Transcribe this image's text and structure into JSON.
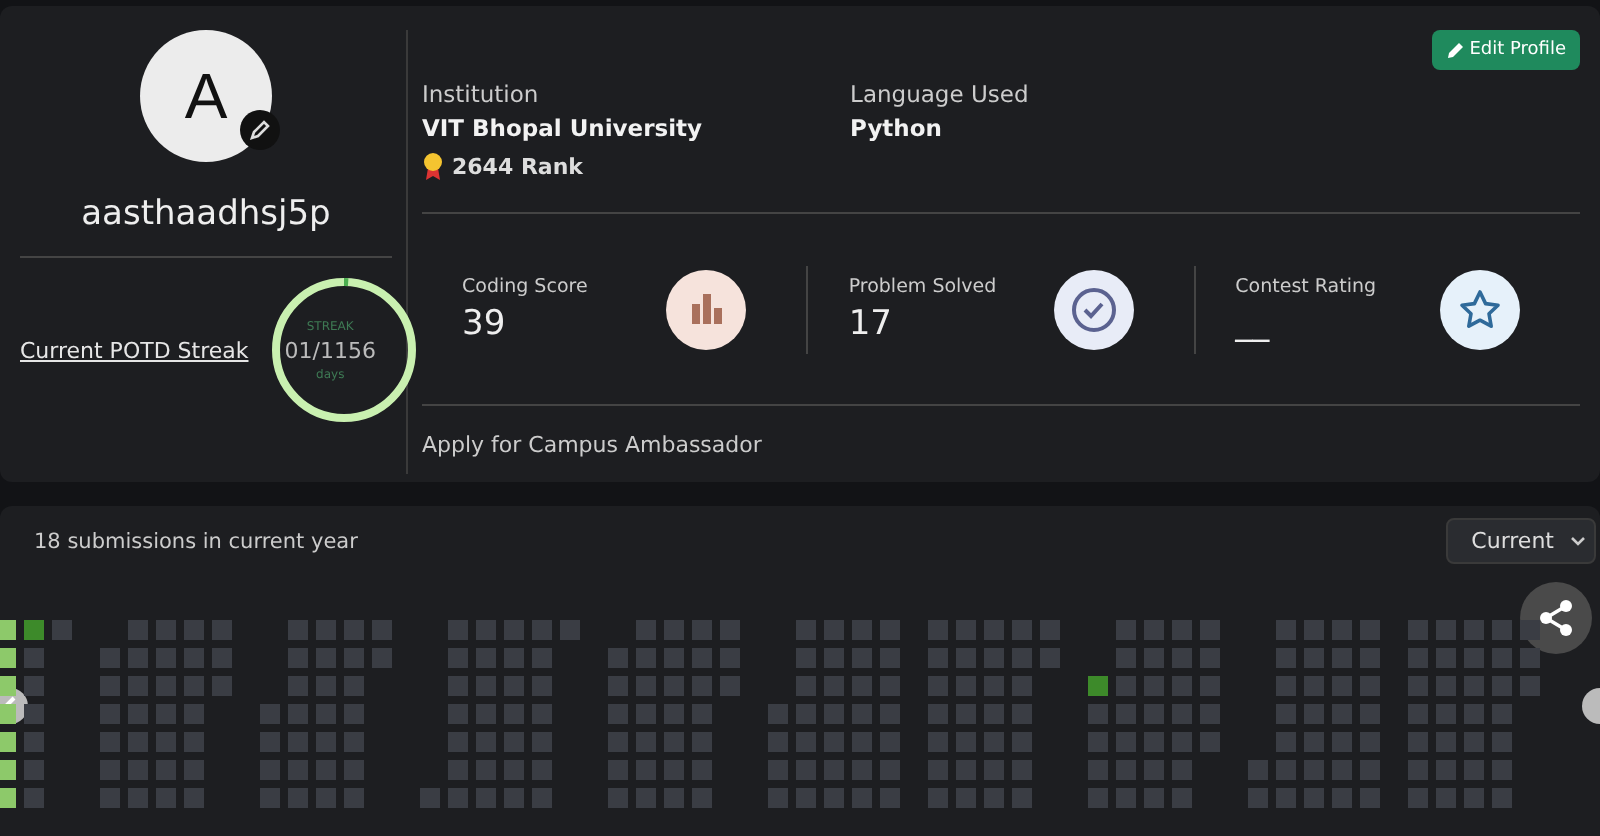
{
  "profile": {
    "avatar_letter": "A",
    "username": "aasthaadhsj5p",
    "streak_link": "Current POTD Streak",
    "streak": {
      "label": "STREAK",
      "value": "01/1156",
      "unit": "days",
      "level": 0.01
    }
  },
  "edit_button": "Edit Profile",
  "info": [
    {
      "label": "Institution",
      "value": "VIT Bhopal University",
      "rank": "2644 Rank"
    },
    {
      "label": "Language Used",
      "value": "Python"
    }
  ],
  "stats": [
    {
      "label": "Coding Score",
      "value": "39",
      "kind": "score"
    },
    {
      "label": "Problem Solved",
      "value": "17",
      "kind": "solved"
    },
    {
      "label": "Contest Rating",
      "value": "__",
      "kind": "rating"
    }
  ],
  "campus_link": "Apply for Campus Ambassador",
  "submissions": {
    "title": "18 submissions in current year",
    "year_select": "Current"
  },
  "heatmap": {
    "months": [
      {
        "weeks": [
          {
            "cells": [
              {
                "color": "#8dc96a"
              },
              {
                "color": "#8dc96a"
              },
              {
                "color": "#8dc96a"
              },
              {
                "color": "#8dc96a"
              },
              {
                "color": "#8dc96a"
              },
              {
                "color": "#8dc96a"
              },
              {
                "color": "#8dc96a"
              }
            ]
          },
          {
            "cells": [
              {
                "color": "#3d8a2a"
              },
              {
                "color": "#3a3d44"
              },
              {
                "color": "#3a3d44"
              },
              {
                "color": "#3a3d44"
              },
              {
                "color": "#3a3d44"
              },
              {
                "color": "#3a3d44"
              },
              {
                "color": "#3a3d44"
              }
            ]
          },
          {
            "cells": [
              {
                "color": "#3a3d44"
              }
            ]
          }
        ]
      },
      {
        "weeks": [
          {
            "bottom": true,
            "cells": [
              {
                "color": "#3a3d44"
              },
              {
                "color": "#3a3d44"
              },
              {
                "color": "#3a3d44"
              },
              {
                "color": "#3a3d44"
              },
              {
                "color": "#3a3d44"
              },
              {
                "color": "#3a3d44"
              }
            ]
          },
          {
            "cells": [
              {
                "color": "#3a3d44"
              },
              {
                "color": "#3a3d44"
              },
              {
                "color": "#3a3d44"
              },
              {
                "color": "#3a3d44"
              },
              {
                "color": "#3a3d44"
              },
              {
                "color": "#3a3d44"
              },
              {
                "color": "#3a3d44"
              }
            ]
          },
          {
            "cells": [
              {
                "color": "#3a3d44"
              },
              {
                "color": "#3a3d44"
              },
              {
                "color": "#3a3d44"
              },
              {
                "color": "#3a3d44"
              },
              {
                "color": "#3a3d44"
              },
              {
                "color": "#3a3d44"
              },
              {
                "color": "#3a3d44"
              }
            ]
          },
          {
            "cells": [
              {
                "color": "#3a3d44"
              },
              {
                "color": "#3a3d44"
              },
              {
                "color": "#3a3d44"
              },
              {
                "color": "#3a3d44"
              },
              {
                "color": "#3a3d44"
              },
              {
                "color": "#3a3d44"
              },
              {
                "color": "#3a3d44"
              }
            ]
          },
          {
            "cells": [
              {
                "color": "#3a3d44"
              },
              {
                "color": "#3a3d44"
              },
              {
                "color": "#3a3d44"
              }
            ]
          }
        ]
      },
      {
        "weeks": [
          {
            "bottom": true,
            "cells": [
              {
                "color": "#3a3d44"
              },
              {
                "color": "#3a3d44"
              },
              {
                "color": "#3a3d44"
              },
              {
                "color": "#3a3d44"
              }
            ]
          },
          {
            "cells": [
              {
                "color": "#3a3d44"
              },
              {
                "color": "#3a3d44"
              },
              {
                "color": "#3a3d44"
              },
              {
                "color": "#3a3d44"
              },
              {
                "color": "#3a3d44"
              },
              {
                "color": "#3a3d44"
              },
              {
                "color": "#3a3d44"
              }
            ]
          },
          {
            "cells": [
              {
                "color": "#3a3d44"
              },
              {
                "color": "#3a3d44"
              },
              {
                "color": "#3a3d44"
              },
              {
                "color": "#3a3d44"
              },
              {
                "color": "#3a3d44"
              },
              {
                "color": "#3a3d44"
              },
              {
                "color": "#3a3d44"
              }
            ]
          },
          {
            "cells": [
              {
                "color": "#3a3d44"
              },
              {
                "color": "#3a3d44"
              },
              {
                "color": "#3a3d44"
              },
              {
                "color": "#3a3d44"
              },
              {
                "color": "#3a3d44"
              },
              {
                "color": "#3a3d44"
              },
              {
                "color": "#3a3d44"
              }
            ]
          },
          {
            "cells": [
              {
                "color": "#3a3d44"
              },
              {
                "color": "#3a3d44"
              }
            ]
          }
        ]
      },
      {
        "weeks": [
          {
            "bottom": true,
            "cells": [
              {
                "color": "#3a3d44"
              }
            ]
          },
          {
            "cells": [
              {
                "color": "#3a3d44"
              },
              {
                "color": "#3a3d44"
              },
              {
                "color": "#3a3d44"
              },
              {
                "color": "#3a3d44"
              },
              {
                "color": "#3a3d44"
              },
              {
                "color": "#3a3d44"
              },
              {
                "color": "#3a3d44"
              }
            ]
          },
          {
            "cells": [
              {
                "color": "#3a3d44"
              },
              {
                "color": "#3a3d44"
              },
              {
                "color": "#3a3d44"
              },
              {
                "color": "#3a3d44"
              },
              {
                "color": "#3a3d44"
              },
              {
                "color": "#3a3d44"
              },
              {
                "color": "#3a3d44"
              }
            ]
          },
          {
            "cells": [
              {
                "color": "#3a3d44"
              },
              {
                "color": "#3a3d44"
              },
              {
                "color": "#3a3d44"
              },
              {
                "color": "#3a3d44"
              },
              {
                "color": "#3a3d44"
              },
              {
                "color": "#3a3d44"
              },
              {
                "color": "#3a3d44"
              }
            ]
          },
          {
            "cells": [
              {
                "color": "#3a3d44"
              },
              {
                "color": "#3a3d44"
              },
              {
                "color": "#3a3d44"
              },
              {
                "color": "#3a3d44"
              },
              {
                "color": "#3a3d44"
              },
              {
                "color": "#3a3d44"
              },
              {
                "color": "#3a3d44"
              }
            ]
          },
          {
            "cells": [
              {
                "color": "#3a3d44"
              }
            ]
          }
        ]
      },
      {
        "weeks": [
          {
            "bottom": true,
            "cells": [
              {
                "color": "#3a3d44"
              },
              {
                "color": "#3a3d44"
              },
              {
                "color": "#3a3d44"
              },
              {
                "color": "#3a3d44"
              },
              {
                "color": "#3a3d44"
              },
              {
                "color": "#3a3d44"
              }
            ]
          },
          {
            "cells": [
              {
                "color": "#3a3d44"
              },
              {
                "color": "#3a3d44"
              },
              {
                "color": "#3a3d44"
              },
              {
                "color": "#3a3d44"
              },
              {
                "color": "#3a3d44"
              },
              {
                "color": "#3a3d44"
              },
              {
                "color": "#3a3d44"
              }
            ]
          },
          {
            "cells": [
              {
                "color": "#3a3d44"
              },
              {
                "color": "#3a3d44"
              },
              {
                "color": "#3a3d44"
              },
              {
                "color": "#3a3d44"
              },
              {
                "color": "#3a3d44"
              },
              {
                "color": "#3a3d44"
              },
              {
                "color": "#3a3d44"
              }
            ]
          },
          {
            "cells": [
              {
                "color": "#3a3d44"
              },
              {
                "color": "#3a3d44"
              },
              {
                "color": "#3a3d44"
              },
              {
                "color": "#3a3d44"
              },
              {
                "color": "#3a3d44"
              },
              {
                "color": "#3a3d44"
              },
              {
                "color": "#3a3d44"
              }
            ]
          },
          {
            "cells": [
              {
                "color": "#3a3d44"
              },
              {
                "color": "#3a3d44"
              },
              {
                "color": "#3a3d44"
              }
            ]
          }
        ]
      },
      {
        "weeks": [
          {
            "bottom": true,
            "cells": [
              {
                "color": "#3a3d44"
              },
              {
                "color": "#3a3d44"
              },
              {
                "color": "#3a3d44"
              },
              {
                "color": "#3a3d44"
              }
            ]
          },
          {
            "cells": [
              {
                "color": "#3a3d44"
              },
              {
                "color": "#3a3d44"
              },
              {
                "color": "#3a3d44"
              },
              {
                "color": "#3a3d44"
              },
              {
                "color": "#3a3d44"
              },
              {
                "color": "#3a3d44"
              },
              {
                "color": "#3a3d44"
              }
            ]
          },
          {
            "cells": [
              {
                "color": "#3a3d44"
              },
              {
                "color": "#3a3d44"
              },
              {
                "color": "#3a3d44"
              },
              {
                "color": "#3a3d44"
              },
              {
                "color": "#3a3d44"
              },
              {
                "color": "#3a3d44"
              },
              {
                "color": "#3a3d44"
              }
            ]
          },
          {
            "cells": [
              {
                "color": "#3a3d44"
              },
              {
                "color": "#3a3d44"
              },
              {
                "color": "#3a3d44"
              },
              {
                "color": "#3a3d44"
              },
              {
                "color": "#3a3d44"
              },
              {
                "color": "#3a3d44"
              },
              {
                "color": "#3a3d44"
              }
            ]
          },
          {
            "cells": [
              {
                "color": "#3a3d44"
              },
              {
                "color": "#3a3d44"
              },
              {
                "color": "#3a3d44"
              },
              {
                "color": "#3a3d44"
              },
              {
                "color": "#3a3d44"
              },
              {
                "color": "#3a3d44"
              },
              {
                "color": "#3a3d44"
              }
            ]
          }
        ]
      },
      {
        "weeks": [
          {
            "cells": [
              {
                "color": "#3a3d44"
              },
              {
                "color": "#3a3d44"
              },
              {
                "color": "#3a3d44"
              },
              {
                "color": "#3a3d44"
              },
              {
                "color": "#3a3d44"
              },
              {
                "color": "#3a3d44"
              },
              {
                "color": "#3a3d44"
              }
            ]
          },
          {
            "cells": [
              {
                "color": "#3a3d44"
              },
              {
                "color": "#3a3d44"
              },
              {
                "color": "#3a3d44"
              },
              {
                "color": "#3a3d44"
              },
              {
                "color": "#3a3d44"
              },
              {
                "color": "#3a3d44"
              },
              {
                "color": "#3a3d44"
              }
            ]
          },
          {
            "cells": [
              {
                "color": "#3a3d44"
              },
              {
                "color": "#3a3d44"
              },
              {
                "color": "#3a3d44"
              },
              {
                "color": "#3a3d44"
              },
              {
                "color": "#3a3d44"
              },
              {
                "color": "#3a3d44"
              },
              {
                "color": "#3a3d44"
              }
            ]
          },
          {
            "cells": [
              {
                "color": "#3a3d44"
              },
              {
                "color": "#3a3d44"
              },
              {
                "color": "#3a3d44"
              },
              {
                "color": "#3a3d44"
              },
              {
                "color": "#3a3d44"
              },
              {
                "color": "#3a3d44"
              },
              {
                "color": "#3a3d44"
              }
            ]
          },
          {
            "cells": [
              {
                "color": "#3a3d44"
              },
              {
                "color": "#3a3d44"
              }
            ]
          }
        ]
      },
      {
        "weeks": [
          {
            "bottom": true,
            "cells": [
              {
                "color": "#3d8a2a"
              },
              {
                "color": "#3a3d44"
              },
              {
                "color": "#3a3d44"
              },
              {
                "color": "#3a3d44"
              },
              {
                "color": "#3a3d44"
              }
            ]
          },
          {
            "cells": [
              {
                "color": "#3a3d44"
              },
              {
                "color": "#3a3d44"
              },
              {
                "color": "#3a3d44"
              },
              {
                "color": "#3a3d44"
              },
              {
                "color": "#3a3d44"
              },
              {
                "color": "#3a3d44"
              },
              {
                "color": "#3a3d44"
              }
            ]
          },
          {
            "cells": [
              {
                "color": "#3a3d44"
              },
              {
                "color": "#3a3d44"
              },
              {
                "color": "#3a3d44"
              },
              {
                "color": "#3a3d44"
              },
              {
                "color": "#3a3d44"
              },
              {
                "color": "#3a3d44"
              },
              {
                "color": "#3a3d44"
              }
            ]
          },
          {
            "cells": [
              {
                "color": "#3a3d44"
              },
              {
                "color": "#3a3d44"
              },
              {
                "color": "#3a3d44"
              },
              {
                "color": "#3a3d44"
              },
              {
                "color": "#3a3d44"
              },
              {
                "color": "#3a3d44"
              },
              {
                "color": "#3a3d44"
              }
            ]
          },
          {
            "cells": [
              {
                "color": "#3a3d44"
              },
              {
                "color": "#3a3d44"
              },
              {
                "color": "#3a3d44"
              },
              {
                "color": "#3a3d44"
              },
              {
                "color": "#3a3d44"
              }
            ]
          }
        ]
      },
      {
        "weeks": [
          {
            "bottom": true,
            "cells": [
              {
                "color": "#3a3d44"
              },
              {
                "color": "#3a3d44"
              }
            ]
          },
          {
            "cells": [
              {
                "color": "#3a3d44"
              },
              {
                "color": "#3a3d44"
              },
              {
                "color": "#3a3d44"
              },
              {
                "color": "#3a3d44"
              },
              {
                "color": "#3a3d44"
              },
              {
                "color": "#3a3d44"
              },
              {
                "color": "#3a3d44"
              }
            ]
          },
          {
            "cells": [
              {
                "color": "#3a3d44"
              },
              {
                "color": "#3a3d44"
              },
              {
                "color": "#3a3d44"
              },
              {
                "color": "#3a3d44"
              },
              {
                "color": "#3a3d44"
              },
              {
                "color": "#3a3d44"
              },
              {
                "color": "#3a3d44"
              }
            ]
          },
          {
            "cells": [
              {
                "color": "#3a3d44"
              },
              {
                "color": "#3a3d44"
              },
              {
                "color": "#3a3d44"
              },
              {
                "color": "#3a3d44"
              },
              {
                "color": "#3a3d44"
              },
              {
                "color": "#3a3d44"
              },
              {
                "color": "#3a3d44"
              }
            ]
          },
          {
            "cells": [
              {
                "color": "#3a3d44"
              },
              {
                "color": "#3a3d44"
              },
              {
                "color": "#3a3d44"
              },
              {
                "color": "#3a3d44"
              },
              {
                "color": "#3a3d44"
              },
              {
                "color": "#3a3d44"
              },
              {
                "color": "#3a3d44"
              }
            ]
          }
        ]
      },
      {
        "weeks": [
          {
            "cells": [
              {
                "color": "#3a3d44"
              },
              {
                "color": "#3a3d44"
              },
              {
                "color": "#3a3d44"
              },
              {
                "color": "#3a3d44"
              },
              {
                "color": "#3a3d44"
              },
              {
                "color": "#3a3d44"
              },
              {
                "color": "#3a3d44"
              }
            ]
          },
          {
            "cells": [
              {
                "color": "#3a3d44"
              },
              {
                "color": "#3a3d44"
              },
              {
                "color": "#3a3d44"
              },
              {
                "color": "#3a3d44"
              },
              {
                "color": "#3a3d44"
              },
              {
                "color": "#3a3d44"
              },
              {
                "color": "#3a3d44"
              }
            ]
          },
          {
            "cells": [
              {
                "color": "#3a3d44"
              },
              {
                "color": "#3a3d44"
              },
              {
                "color": "#3a3d44"
              },
              {
                "color": "#3a3d44"
              },
              {
                "color": "#3a3d44"
              },
              {
                "color": "#3a3d44"
              },
              {
                "color": "#3a3d44"
              }
            ]
          },
          {
            "cells": [
              {
                "color": "#3a3d44"
              },
              {
                "color": "#3a3d44"
              },
              {
                "color": "#3a3d44"
              },
              {
                "color": "#3a3d44"
              },
              {
                "color": "#3a3d44"
              },
              {
                "color": "#3a3d44"
              },
              {
                "color": "#3a3d44"
              }
            ]
          },
          {
            "cells": [
              {
                "color": "#3a3d44"
              },
              {
                "color": "#3a3d44"
              },
              {
                "color": "#3a3d44"
              }
            ]
          }
        ]
      }
    ]
  }
}
